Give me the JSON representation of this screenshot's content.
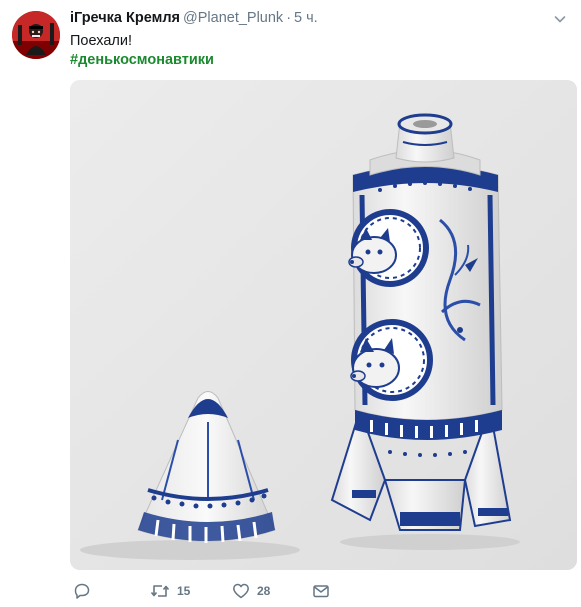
{
  "tweet": {
    "author_name": "іГречка Кремля",
    "handle": "@Planet_Plunk",
    "separator": "·",
    "time": "5 ч.",
    "text": "Поехали!",
    "hashtag": "#денькосмонавтики"
  },
  "actions": {
    "reply_icon": "reply-icon",
    "retweet_icon": "retweet-icon",
    "retweet_count": "15",
    "like_icon": "heart-icon",
    "like_count": "28",
    "dm_icon": "envelope-icon"
  },
  "colors": {
    "hashtag": "#1b8a2f",
    "muted": "#657786",
    "porcelain_blue": "#1f3d8f"
  }
}
